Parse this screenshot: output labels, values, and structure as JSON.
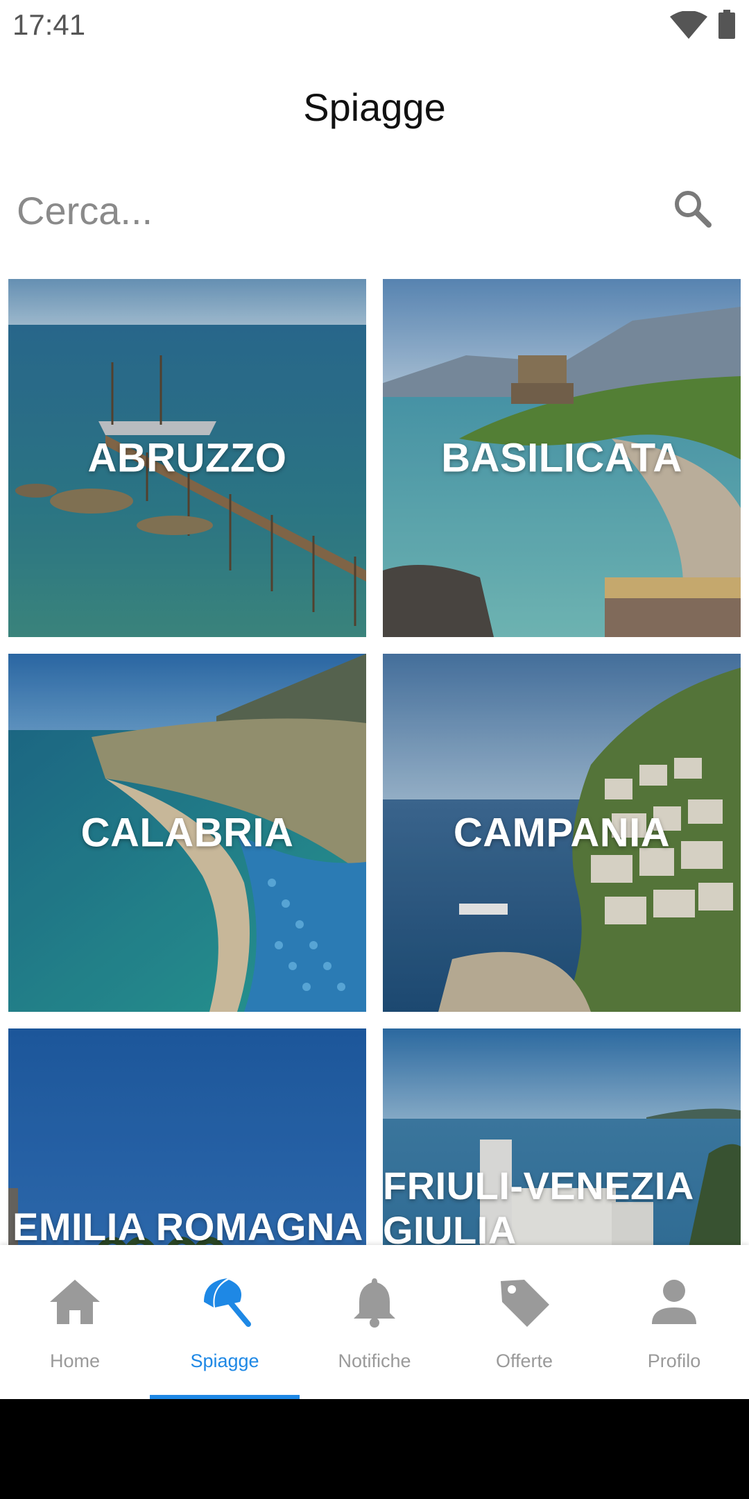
{
  "status_bar": {
    "time": "17:41",
    "icons": [
      "wifi-icon",
      "battery-icon"
    ]
  },
  "header": {
    "title": "Spiagge"
  },
  "search": {
    "placeholder": "Cerca...",
    "value": "",
    "icon": "search-icon"
  },
  "regions": [
    {
      "label": "ABRUZZO"
    },
    {
      "label": "BASILICATA"
    },
    {
      "label": "CALABRIA"
    },
    {
      "label": "CAMPANIA"
    },
    {
      "label": "EMILIA ROMAGNA"
    },
    {
      "label": "FRIULI-VENEZIA GIULIA"
    }
  ],
  "bottom_nav": {
    "items": [
      {
        "label": "Home",
        "icon": "home-icon"
      },
      {
        "label": "Spiagge",
        "icon": "beach-umbrella-icon",
        "active": true
      },
      {
        "label": "Notifiche",
        "icon": "bell-icon"
      },
      {
        "label": "Offerte",
        "icon": "tag-icon"
      },
      {
        "label": "Profilo",
        "icon": "person-icon"
      }
    ],
    "active_color": "#1e88e5",
    "inactive_color": "#9a9a9a"
  }
}
